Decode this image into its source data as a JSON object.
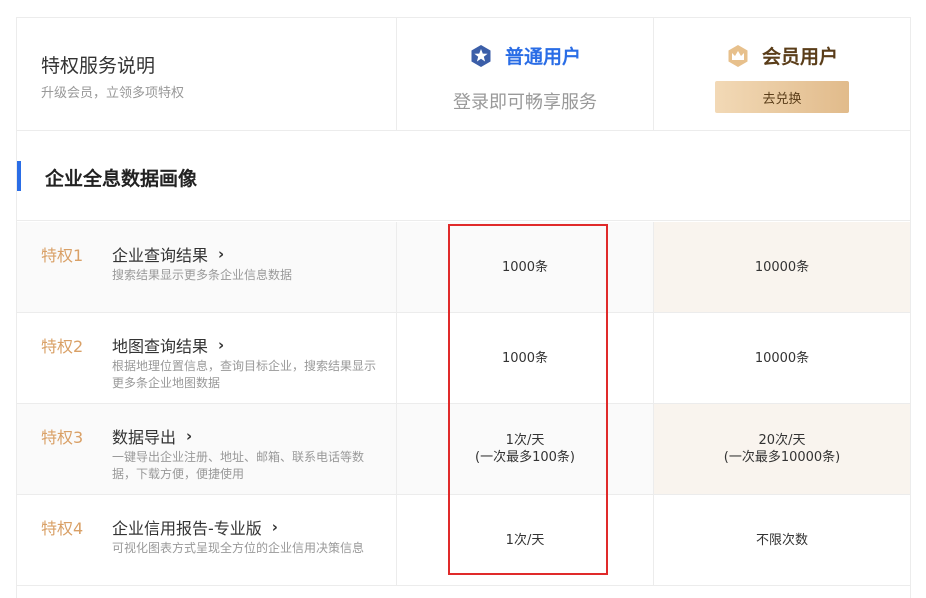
{
  "header": {
    "title": "特权服务说明",
    "subtitle": "升级会员，立领多项特权",
    "plans": {
      "normal": {
        "name": "普通用户",
        "desc": "登录即可畅享服务",
        "icon": "blue-star-badge-icon",
        "color": "#2a6de6"
      },
      "member": {
        "name": "会员用户",
        "button_label": "去兑换",
        "icon": "gold-crown-badge-icon",
        "color": "#5a3d19"
      }
    }
  },
  "section": {
    "title": "企业全息数据画像",
    "accent": "#2a6de6"
  },
  "privileges": [
    {
      "label": "特权1",
      "name": "企业查询结果",
      "desc": "搜索结果显示更多条企业信息数据",
      "normal": [
        "1000条"
      ],
      "member": [
        "10000条"
      ]
    },
    {
      "label": "特权2",
      "name": "地图查询结果",
      "desc": "根据地理位置信息，查询目标企业，搜索结果显示更多条企业地图数据",
      "normal": [
        "1000条"
      ],
      "member": [
        "10000条"
      ]
    },
    {
      "label": "特权3",
      "name": "数据导出",
      "desc": "一键导出企业注册、地址、邮箱、联系电话等数据，下载方便，便捷使用",
      "normal": [
        "1次/天",
        "(一次最多100条)"
      ],
      "member": [
        "20次/天",
        "(一次最多10000条)"
      ]
    },
    {
      "label": "特权4",
      "name": "企业信用报告-专业版",
      "desc": "可视化图表方式呈现全方位的企业信用决策信息",
      "normal": [
        "1次/天"
      ],
      "member": [
        "不限次数"
      ]
    }
  ],
  "colors": {
    "privilege_label": "#d9a066",
    "member_cell_bg": "#f9f4ee",
    "highlight": "#e02a2a"
  }
}
